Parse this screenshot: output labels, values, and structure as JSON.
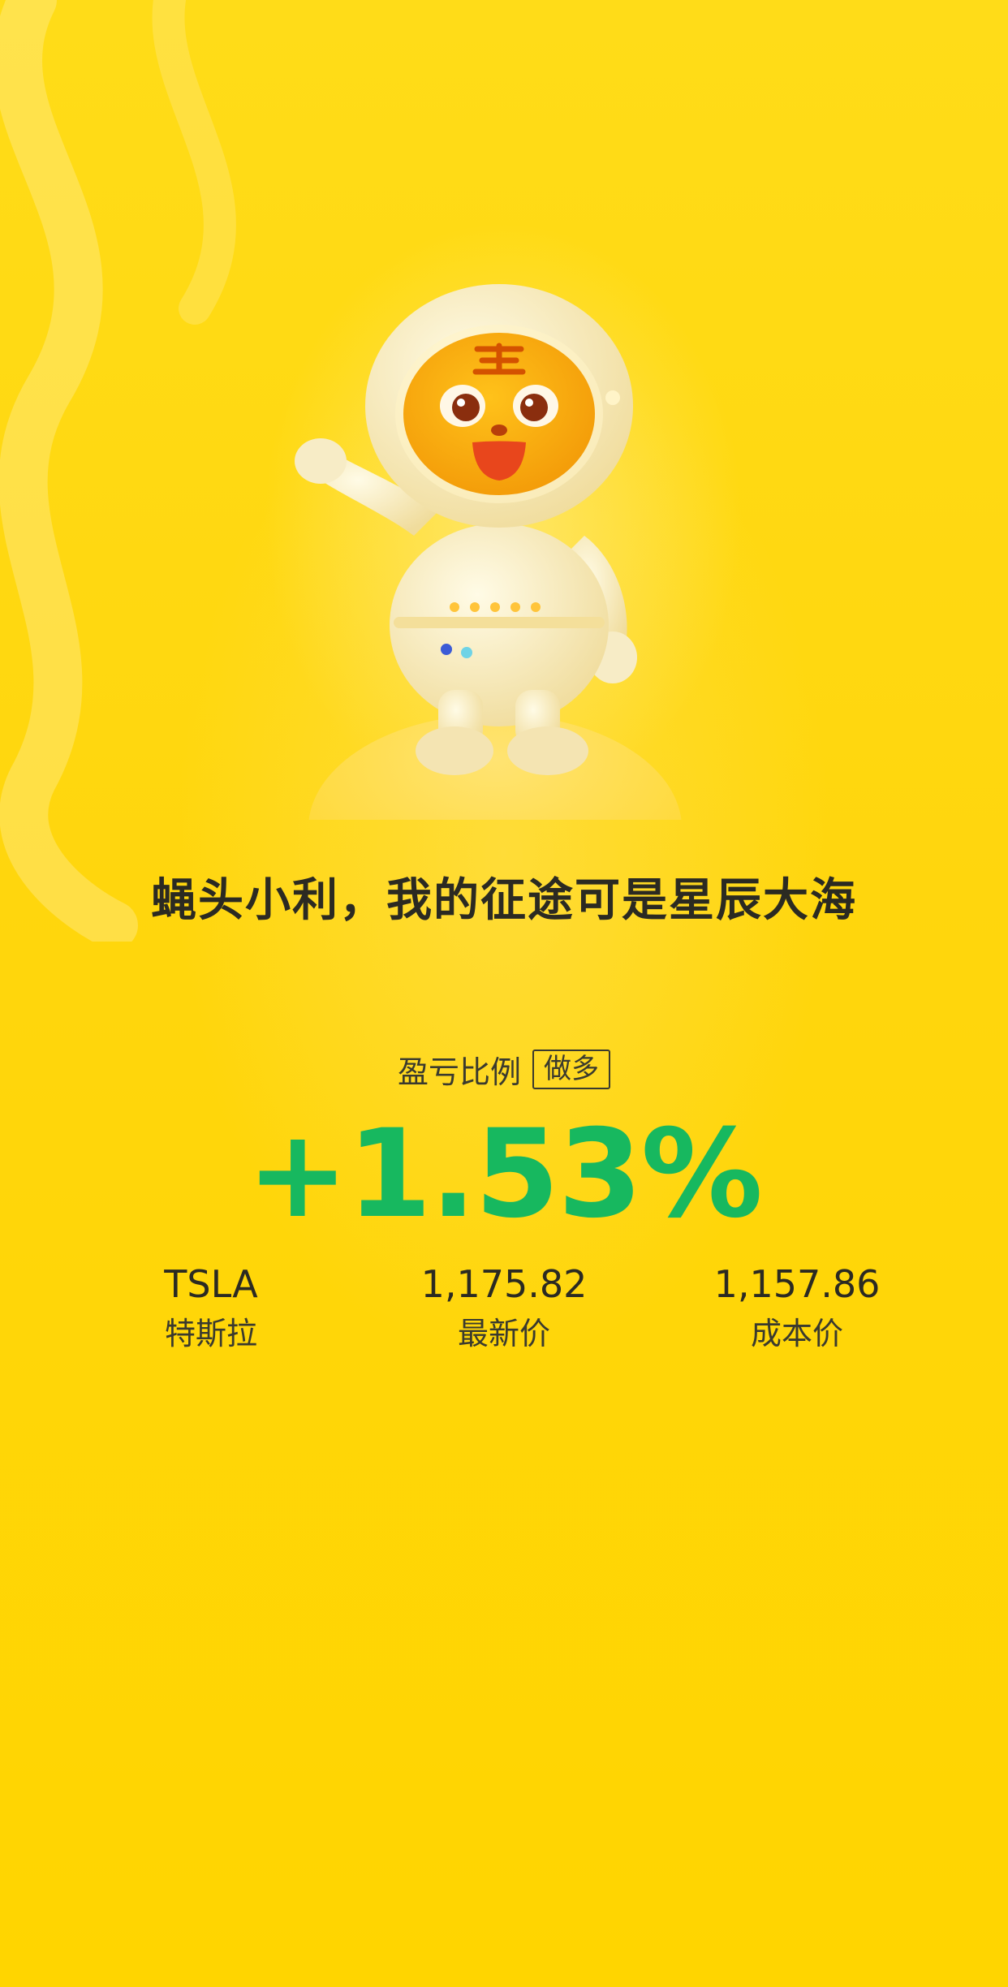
{
  "slogan": "蝇头小利，我的征途可是星辰大海",
  "profit": {
    "label": "盈亏比例",
    "direction": "做多",
    "percent": "+1.53%",
    "color": "#17b85f"
  },
  "stats": [
    {
      "value": "TSLA",
      "label": "特斯拉"
    },
    {
      "value": "1,175.82",
      "label": "最新价"
    },
    {
      "value": "1,157.86",
      "label": "成本价"
    }
  ],
  "mascot": {
    "icon": "tiger-astronaut-mascot"
  },
  "colors": {
    "background": "#ffd90a",
    "text": "#2b2a22"
  }
}
